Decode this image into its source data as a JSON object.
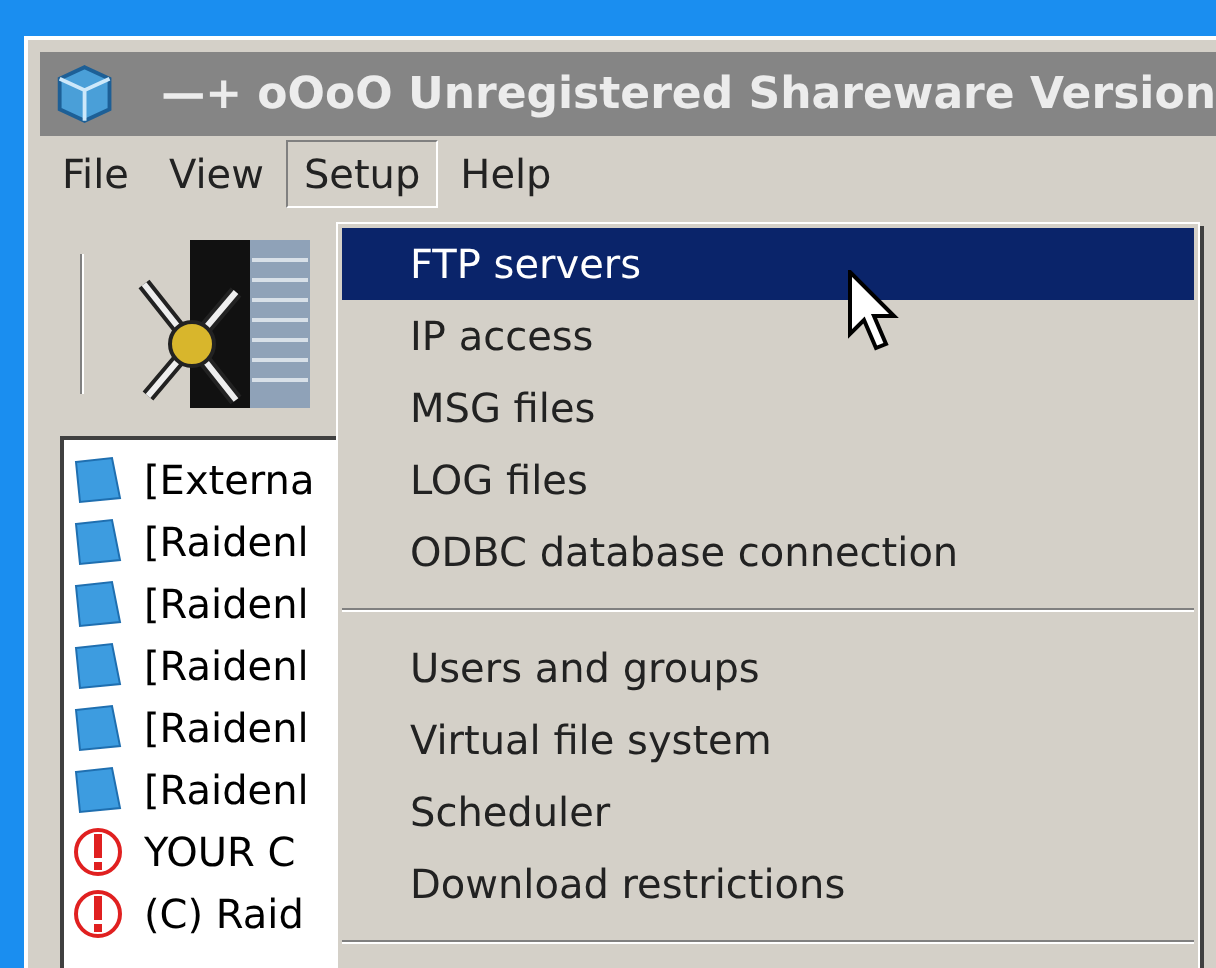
{
  "window": {
    "title": "—+ oOoO Unregistered Shareware Version"
  },
  "menu_bar": [
    {
      "label": "File",
      "selected": false
    },
    {
      "label": "View",
      "selected": false
    },
    {
      "label": "Setup",
      "selected": true
    },
    {
      "label": "Help",
      "selected": false
    }
  ],
  "list": [
    {
      "kind": "server",
      "text": "[Externa"
    },
    {
      "kind": "server",
      "text": "[Raidenl"
    },
    {
      "kind": "server",
      "text": "[Raidenl"
    },
    {
      "kind": "server",
      "text": "[Raidenl"
    },
    {
      "kind": "server",
      "text": "[Raidenl"
    },
    {
      "kind": "server",
      "text": "[Raidenl"
    },
    {
      "kind": "warning",
      "text": "YOUR C"
    },
    {
      "kind": "warning",
      "text": "(C) Raid"
    }
  ],
  "dropdown": [
    {
      "kind": "item",
      "label": "FTP servers",
      "selected": true
    },
    {
      "kind": "item",
      "label": "IP access",
      "selected": false
    },
    {
      "kind": "item",
      "label": "MSG files",
      "selected": false
    },
    {
      "kind": "item",
      "label": "LOG files",
      "selected": false
    },
    {
      "kind": "item",
      "label": "ODBC database connection",
      "selected": false
    },
    {
      "kind": "separator"
    },
    {
      "kind": "item",
      "label": "Users and groups",
      "selected": false
    },
    {
      "kind": "item",
      "label": "Virtual file system",
      "selected": false
    },
    {
      "kind": "item",
      "label": "Scheduler",
      "selected": false
    },
    {
      "kind": "item",
      "label": "Download restrictions",
      "selected": false
    },
    {
      "kind": "separator"
    }
  ]
}
